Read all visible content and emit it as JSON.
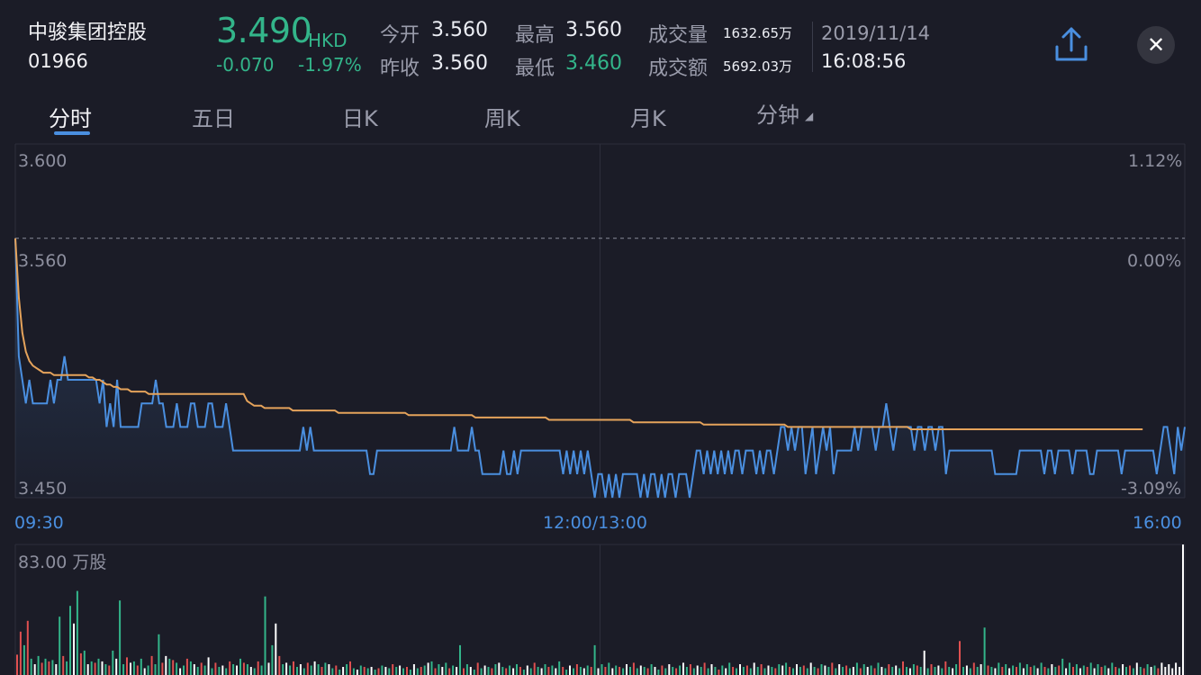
{
  "stock": {
    "name": "中骏集团控股",
    "code": "01966",
    "price": "3.490",
    "currency": "HKD",
    "change": "-0.070",
    "change_pct": "-1.97%",
    "open_label": "今开",
    "open": "3.560",
    "prev_close_label": "昨收",
    "prev_close": "3.560",
    "high_label": "最高",
    "high": "3.560",
    "low_label": "最低",
    "low": "3.460",
    "volume_label": "成交量",
    "volume": "1632.65万",
    "turnover_label": "成交额",
    "turnover": "5692.03万",
    "date": "2019/11/14",
    "time": "16:08:56"
  },
  "icons": {
    "share": "share-upload-icon",
    "close": "close-icon",
    "dropdown": "triangle-icon"
  },
  "tabs": [
    {
      "label": "分时",
      "active": true
    },
    {
      "label": "五日"
    },
    {
      "label": "日K"
    },
    {
      "label": "周K"
    },
    {
      "label": "月K"
    },
    {
      "label": "分钟",
      "dropdown": true
    }
  ],
  "colors": {
    "background": "#1b1c27",
    "up": "#33b58a",
    "price_line": "#4a8fe0",
    "avg_line": "#e5a35b",
    "volume_up": "#e05050",
    "volume_down": "#33b58a",
    "volume_neutral": "#ffffff"
  },
  "chart_data": {
    "type": "line",
    "y_left_ticks": [
      "3.600",
      "3.560",
      "3.450"
    ],
    "y_right_ticks": [
      "1.12%",
      "0.00%",
      "-3.09%"
    ],
    "x_ticks": [
      "09:30",
      "12:00/13:00",
      "16:00"
    ],
    "ylim": [
      3.45,
      3.6
    ],
    "baseline": 3.56,
    "volume_label": "83.00 万股",
    "volume_max": 83.0,
    "series": [
      {
        "name": "price",
        "values": [
          3.56,
          3.51,
          3.5,
          3.49,
          3.5,
          3.49,
          3.49,
          3.49,
          3.49,
          3.49,
          3.5,
          3.49,
          3.5,
          3.5,
          3.51,
          3.5,
          3.5,
          3.5,
          3.5,
          3.5,
          3.5,
          3.5,
          3.5,
          3.5,
          3.49,
          3.5,
          3.48,
          3.49,
          3.48,
          3.5,
          3.48,
          3.48,
          3.48,
          3.48,
          3.48,
          3.48,
          3.49,
          3.49,
          3.49,
          3.49,
          3.5,
          3.49,
          3.49,
          3.48,
          3.48,
          3.48,
          3.49,
          3.48,
          3.48,
          3.48,
          3.49,
          3.49,
          3.48,
          3.48,
          3.48,
          3.49,
          3.49,
          3.48,
          3.48,
          3.48,
          3.49,
          3.48,
          3.47,
          3.47,
          3.47,
          3.47,
          3.47,
          3.47,
          3.47,
          3.47,
          3.47,
          3.47,
          3.47,
          3.47,
          3.47,
          3.47,
          3.47,
          3.47,
          3.47,
          3.47,
          3.47,
          3.47,
          3.48,
          3.47,
          3.48,
          3.47,
          3.47,
          3.47,
          3.47,
          3.47,
          3.47,
          3.47,
          3.47,
          3.47,
          3.47,
          3.47,
          3.47,
          3.47,
          3.47,
          3.47,
          3.47,
          3.46,
          3.46,
          3.47,
          3.47,
          3.47,
          3.47,
          3.47,
          3.47,
          3.47,
          3.47,
          3.47,
          3.47,
          3.47,
          3.47,
          3.47,
          3.47,
          3.47,
          3.47,
          3.47,
          3.47,
          3.47,
          3.47,
          3.47,
          3.47,
          3.48,
          3.47,
          3.47,
          3.47,
          3.47,
          3.48,
          3.47,
          3.47,
          3.46,
          3.46,
          3.46,
          3.46,
          3.46,
          3.46,
          3.47,
          3.46,
          3.46,
          3.47,
          3.46,
          3.47,
          3.47,
          3.47,
          3.47,
          3.47,
          3.47,
          3.47,
          3.47,
          3.47,
          3.47,
          3.47,
          3.47,
          3.46,
          3.47,
          3.46,
          3.47,
          3.46,
          3.47,
          3.46,
          3.47,
          3.46,
          3.45,
          3.46,
          3.46,
          3.45,
          3.46,
          3.45,
          3.46,
          3.45,
          3.46,
          3.46,
          3.46,
          3.46,
          3.46,
          3.45,
          3.46,
          3.45,
          3.46,
          3.46,
          3.45,
          3.46,
          3.45,
          3.46,
          3.46,
          3.45,
          3.46,
          3.46,
          3.46,
          3.45,
          3.46,
          3.47,
          3.47,
          3.46,
          3.47,
          3.46,
          3.47,
          3.46,
          3.47,
          3.46,
          3.47,
          3.46,
          3.47,
          3.47,
          3.46,
          3.47,
          3.47,
          3.47,
          3.46,
          3.47,
          3.46,
          3.47,
          3.47,
          3.46,
          3.47,
          3.48,
          3.48,
          3.47,
          3.48,
          3.47,
          3.48,
          3.48,
          3.46,
          3.47,
          3.48,
          3.46,
          3.47,
          3.48,
          3.47,
          3.48,
          3.46,
          3.47,
          3.47,
          3.47,
          3.47,
          3.47,
          3.48,
          3.47,
          3.48,
          3.48,
          3.48,
          3.48,
          3.47,
          3.48,
          3.48,
          3.49,
          3.48,
          3.47,
          3.48,
          3.48,
          3.48,
          3.48,
          3.48,
          3.47,
          3.48,
          3.48,
          3.47,
          3.48,
          3.48,
          3.47,
          3.48,
          3.48,
          3.46,
          3.47,
          3.47,
          3.47,
          3.47,
          3.47,
          3.47,
          3.47,
          3.47,
          3.47,
          3.47,
          3.47,
          3.47,
          3.47,
          3.46,
          3.46,
          3.46,
          3.46,
          3.46,
          3.46,
          3.46,
          3.47,
          3.47,
          3.47,
          3.47,
          3.47,
          3.47,
          3.47,
          3.46,
          3.47,
          3.47,
          3.46,
          3.47,
          3.47,
          3.47,
          3.47,
          3.46,
          3.47,
          3.47,
          3.47,
          3.47,
          3.46,
          3.46,
          3.47,
          3.47,
          3.47,
          3.47,
          3.47,
          3.47,
          3.47,
          3.46,
          3.47,
          3.47,
          3.47,
          3.47,
          3.47,
          3.47,
          3.47,
          3.47,
          3.47,
          3.46,
          3.47,
          3.48,
          3.48,
          3.47,
          3.46,
          3.48,
          3.47,
          3.48
        ]
      },
      {
        "name": "average",
        "values": [
          3.56,
          3.535,
          3.52,
          3.512,
          3.508,
          3.506,
          3.505,
          3.504,
          3.503,
          3.503,
          3.503,
          3.502,
          3.502,
          3.502,
          3.502,
          3.502,
          3.502,
          3.502,
          3.502,
          3.502,
          3.502,
          3.501,
          3.501,
          3.5,
          3.5,
          3.499,
          3.498,
          3.498,
          3.497,
          3.497,
          3.496,
          3.496,
          3.496,
          3.495,
          3.495,
          3.495,
          3.495,
          3.495,
          3.494,
          3.494,
          3.494,
          3.494,
          3.494,
          3.494,
          3.494,
          3.494,
          3.494,
          3.494,
          3.494,
          3.494,
          3.494,
          3.494,
          3.494,
          3.494,
          3.494,
          3.494,
          3.494,
          3.494,
          3.494,
          3.494,
          3.494,
          3.494,
          3.494,
          3.494,
          3.494,
          3.494,
          3.491,
          3.49,
          3.489,
          3.489,
          3.489,
          3.488,
          3.488,
          3.488,
          3.488,
          3.488,
          3.488,
          3.488,
          3.488,
          3.487,
          3.487,
          3.487,
          3.487,
          3.487,
          3.487,
          3.487,
          3.487,
          3.487,
          3.487,
          3.487,
          3.487,
          3.487,
          3.486,
          3.486,
          3.486,
          3.486,
          3.486,
          3.486,
          3.486,
          3.486,
          3.486,
          3.486,
          3.486,
          3.486,
          3.486,
          3.486,
          3.486,
          3.486,
          3.486,
          3.486,
          3.486,
          3.486,
          3.485,
          3.485,
          3.485,
          3.485,
          3.485,
          3.485,
          3.485,
          3.485,
          3.485,
          3.485,
          3.485,
          3.485,
          3.485,
          3.485,
          3.485,
          3.485,
          3.485,
          3.485,
          3.485,
          3.484,
          3.484,
          3.484,
          3.484,
          3.484,
          3.484,
          3.484,
          3.484,
          3.484,
          3.484,
          3.484,
          3.484,
          3.484,
          3.484,
          3.484,
          3.484,
          3.484,
          3.484,
          3.484,
          3.484,
          3.484,
          3.483,
          3.483,
          3.483,
          3.483,
          3.483,
          3.483,
          3.483,
          3.483,
          3.483,
          3.483,
          3.483,
          3.483,
          3.483,
          3.483,
          3.483,
          3.483,
          3.483,
          3.483,
          3.483,
          3.483,
          3.483,
          3.483,
          3.483,
          3.483,
          3.482,
          3.482,
          3.482,
          3.482,
          3.482,
          3.482,
          3.482,
          3.482,
          3.482,
          3.482,
          3.482,
          3.482,
          3.482,
          3.482,
          3.482,
          3.482,
          3.482,
          3.482,
          3.482,
          3.482,
          3.481,
          3.481,
          3.481,
          3.481,
          3.481,
          3.481,
          3.481,
          3.481,
          3.481,
          3.481,
          3.481,
          3.481,
          3.481,
          3.481,
          3.481,
          3.481,
          3.481,
          3.481,
          3.481,
          3.481,
          3.481,
          3.481,
          3.481,
          3.481,
          3.48,
          3.48,
          3.48,
          3.48,
          3.48,
          3.48,
          3.48,
          3.48,
          3.48,
          3.48,
          3.48,
          3.48,
          3.48,
          3.48,
          3.48,
          3.48,
          3.48,
          3.48,
          3.48,
          3.48,
          3.48,
          3.48,
          3.48,
          3.48,
          3.48,
          3.48,
          3.48,
          3.48,
          3.48,
          3.48,
          3.48,
          3.48,
          3.48,
          3.48,
          3.48,
          3.479,
          3.479,
          3.479,
          3.479,
          3.479,
          3.479,
          3.479,
          3.479,
          3.479,
          3.479,
          3.479,
          3.479,
          3.479,
          3.479,
          3.479,
          3.479,
          3.479,
          3.479,
          3.479,
          3.479,
          3.479,
          3.479,
          3.479,
          3.479,
          3.479,
          3.479,
          3.479,
          3.479,
          3.479,
          3.479,
          3.479,
          3.479,
          3.479,
          3.479,
          3.479,
          3.479,
          3.479,
          3.479,
          3.479,
          3.479,
          3.479,
          3.479,
          3.479,
          3.479,
          3.479,
          3.479,
          3.479,
          3.479,
          3.479,
          3.479,
          3.479,
          3.479,
          3.479,
          3.479,
          3.479,
          3.479,
          3.479,
          3.479,
          3.479,
          3.479,
          3.479,
          3.479,
          3.479,
          3.479,
          3.479,
          3.479,
          3.479
        ]
      }
    ],
    "volume": [
      15,
      32,
      22,
      40,
      12,
      8,
      14,
      9,
      12,
      10,
      11,
      8,
      43,
      14,
      10,
      51,
      38,
      62,
      16,
      18,
      8,
      10,
      9,
      12,
      10,
      8,
      7,
      18,
      12,
      55,
      8,
      13,
      9,
      10,
      7,
      12,
      5,
      7,
      14,
      8,
      30,
      9,
      14,
      12,
      11,
      9,
      5,
      7,
      12,
      10,
      8,
      6,
      9,
      7,
      13,
      5,
      9,
      6,
      7,
      5,
      10,
      8,
      7,
      12,
      9,
      8,
      6,
      5,
      10,
      7,
      58,
      9,
      22,
      38,
      14,
      8,
      9,
      7,
      10,
      6,
      8,
      5,
      9,
      7,
      10,
      8,
      6,
      9,
      8,
      5,
      7,
      4,
      6,
      8,
      10,
      5,
      4,
      7,
      6,
      5,
      6,
      4,
      5,
      7,
      6,
      5,
      8,
      6,
      7,
      5,
      6,
      4,
      8,
      5,
      6,
      7,
      9,
      10,
      5,
      8,
      6,
      9,
      5,
      7,
      6,
      22,
      5,
      8,
      6,
      4,
      9,
      5,
      7,
      6,
      5,
      8,
      9,
      6,
      5,
      7,
      5,
      8,
      6,
      4,
      7,
      5,
      9,
      6,
      5,
      8,
      6,
      7,
      5,
      10,
      6,
      4,
      7,
      5,
      8,
      6,
      5,
      7,
      6,
      22,
      5,
      8,
      6,
      9,
      5,
      7,
      6,
      5,
      8,
      6,
      9,
      5,
      7,
      6,
      5,
      8,
      6,
      4,
      7,
      5,
      8,
      6,
      5,
      7,
      9,
      6,
      8,
      5,
      7,
      6,
      9,
      5,
      8,
      6,
      4,
      7,
      5,
      9,
      6,
      5,
      8,
      6,
      7,
      5,
      9,
      6,
      8,
      5,
      7,
      6,
      5,
      8,
      7,
      9,
      6,
      5,
      8,
      6,
      7,
      5,
      9,
      6,
      5,
      8,
      7,
      6,
      9,
      5,
      8,
      6,
      7,
      5,
      6,
      9,
      5,
      8,
      6,
      7,
      5,
      9,
      6,
      5,
      8,
      6,
      7,
      5,
      10,
      6,
      5,
      8,
      7,
      6,
      18,
      5,
      8,
      6,
      7,
      5,
      10,
      6,
      5,
      8,
      25,
      6,
      7,
      5,
      9,
      6,
      8,
      35,
      7,
      6,
      5,
      9,
      6,
      8,
      5,
      7,
      6,
      9,
      5,
      8,
      6,
      7,
      5,
      9,
      6,
      5,
      8,
      6,
      7,
      12,
      5,
      9,
      6,
      8,
      5,
      7,
      6,
      9,
      5,
      8,
      6,
      7,
      5,
      9,
      6,
      5,
      8,
      6,
      7,
      5,
      9,
      6,
      5,
      8,
      6,
      7,
      5,
      9,
      6,
      8,
      5,
      9,
      6,
      160
    ],
    "volume_dir": [
      "u",
      "u",
      "d",
      "u",
      "d",
      "n",
      "d",
      "u",
      "d",
      "u",
      "d",
      "n",
      "d",
      "u",
      "d",
      "d",
      "n",
      "d",
      "u",
      "d",
      "n",
      "d",
      "u",
      "d",
      "n",
      "d",
      "u",
      "d",
      "n",
      "d",
      "d",
      "u",
      "n",
      "d",
      "u",
      "d",
      "n",
      "d",
      "u",
      "d",
      "d",
      "u",
      "n",
      "d",
      "u",
      "d",
      "n",
      "d",
      "u",
      "d",
      "n",
      "d",
      "u",
      "d",
      "n",
      "d",
      "u",
      "d",
      "n",
      "d",
      "u",
      "d",
      "n",
      "d",
      "u",
      "d",
      "n",
      "d",
      "u",
      "d",
      "d",
      "n",
      "d",
      "n",
      "u",
      "d",
      "n",
      "d",
      "u",
      "d",
      "n",
      "d",
      "u",
      "d",
      "n",
      "d",
      "u",
      "d",
      "n",
      "d",
      "u",
      "d",
      "n",
      "d",
      "u",
      "d",
      "n",
      "d",
      "u",
      "d",
      "n",
      "d",
      "u",
      "d",
      "n",
      "d",
      "u",
      "d",
      "n",
      "d",
      "u",
      "d",
      "n",
      "d",
      "u",
      "d",
      "n",
      "d",
      "u",
      "d",
      "n",
      "d",
      "u",
      "d",
      "n",
      "d",
      "u",
      "d",
      "n",
      "d",
      "u",
      "d",
      "n",
      "d",
      "u",
      "d",
      "n",
      "d",
      "u",
      "d",
      "n",
      "d",
      "u",
      "d",
      "n",
      "d",
      "u",
      "d",
      "n",
      "d",
      "u",
      "d",
      "n",
      "d",
      "u",
      "d",
      "n",
      "d",
      "u",
      "d",
      "n",
      "d",
      "u",
      "d",
      "n",
      "d",
      "u",
      "d",
      "n",
      "d",
      "u",
      "d",
      "n",
      "d",
      "u",
      "d",
      "n",
      "d",
      "u",
      "d",
      "n",
      "d",
      "u",
      "d",
      "n",
      "d",
      "u",
      "d",
      "n",
      "d",
      "u",
      "d",
      "n",
      "d",
      "u",
      "d",
      "n",
      "d",
      "u",
      "d",
      "n",
      "d",
      "u",
      "d",
      "n",
      "d",
      "u",
      "d",
      "n",
      "d",
      "u",
      "d",
      "n",
      "d",
      "u",
      "d",
      "n",
      "d",
      "u",
      "d",
      "n",
      "d",
      "u",
      "d",
      "n",
      "d",
      "u",
      "d",
      "n",
      "d",
      "u",
      "d",
      "n",
      "d",
      "u",
      "d",
      "n",
      "d",
      "u",
      "d",
      "n",
      "d",
      "u",
      "d",
      "n",
      "d",
      "u",
      "d",
      "n",
      "d",
      "u",
      "d",
      "n",
      "d",
      "u",
      "d",
      "n",
      "d",
      "u",
      "d",
      "n",
      "d",
      "u",
      "d",
      "n",
      "d",
      "u",
      "d",
      "n",
      "d",
      "u",
      "d",
      "n",
      "d",
      "u",
      "d",
      "n",
      "d",
      "u",
      "d",
      "n",
      "d",
      "u",
      "d",
      "n",
      "d",
      "u",
      "d",
      "n",
      "d",
      "u",
      "d",
      "n",
      "d",
      "u",
      "d",
      "n",
      "d",
      "u",
      "d",
      "n",
      "d",
      "u",
      "d",
      "n",
      "d",
      "u",
      "d",
      "n",
      "d",
      "u",
      "d",
      "n",
      "d",
      "u",
      "d",
      "n",
      "d",
      "u",
      "d",
      "n",
      "d",
      "u"
    ]
  }
}
